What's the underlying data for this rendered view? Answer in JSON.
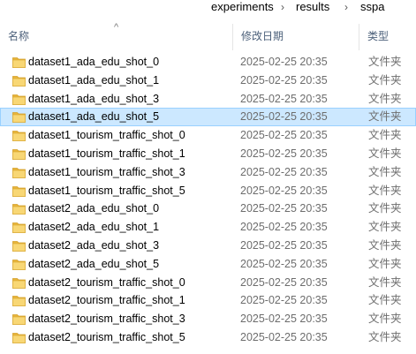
{
  "breadcrumb": {
    "items": [
      "experiments",
      "results",
      "sspa"
    ],
    "separator": "›"
  },
  "columns": {
    "name": "名称",
    "modified": "修改日期",
    "type": "类型",
    "sort_indicator": "^"
  },
  "selected_row_color": "#cce8ff",
  "folder_icon_color": "#f8d775",
  "rows": [
    {
      "name": "dataset1_ada_edu_shot_0",
      "modified": "2025-02-25 20:35",
      "type": "文件夹",
      "selected": false
    },
    {
      "name": "dataset1_ada_edu_shot_1",
      "modified": "2025-02-25 20:35",
      "type": "文件夹",
      "selected": false
    },
    {
      "name": "dataset1_ada_edu_shot_3",
      "modified": "2025-02-25 20:35",
      "type": "文件夹",
      "selected": false
    },
    {
      "name": "dataset1_ada_edu_shot_5",
      "modified": "2025-02-25 20:35",
      "type": "文件夹",
      "selected": true
    },
    {
      "name": "dataset1_tourism_traffic_shot_0",
      "modified": "2025-02-25 20:35",
      "type": "文件夹",
      "selected": false
    },
    {
      "name": "dataset1_tourism_traffic_shot_1",
      "modified": "2025-02-25 20:35",
      "type": "文件夹",
      "selected": false
    },
    {
      "name": "dataset1_tourism_traffic_shot_3",
      "modified": "2025-02-25 20:35",
      "type": "文件夹",
      "selected": false
    },
    {
      "name": "dataset1_tourism_traffic_shot_5",
      "modified": "2025-02-25 20:35",
      "type": "文件夹",
      "selected": false
    },
    {
      "name": "dataset2_ada_edu_shot_0",
      "modified": "2025-02-25 20:35",
      "type": "文件夹",
      "selected": false
    },
    {
      "name": "dataset2_ada_edu_shot_1",
      "modified": "2025-02-25 20:35",
      "type": "文件夹",
      "selected": false
    },
    {
      "name": "dataset2_ada_edu_shot_3",
      "modified": "2025-02-25 20:35",
      "type": "文件夹",
      "selected": false
    },
    {
      "name": "dataset2_ada_edu_shot_5",
      "modified": "2025-02-25 20:35",
      "type": "文件夹",
      "selected": false
    },
    {
      "name": "dataset2_tourism_traffic_shot_0",
      "modified": "2025-02-25 20:35",
      "type": "文件夹",
      "selected": false
    },
    {
      "name": "dataset2_tourism_traffic_shot_1",
      "modified": "2025-02-25 20:35",
      "type": "文件夹",
      "selected": false
    },
    {
      "name": "dataset2_tourism_traffic_shot_3",
      "modified": "2025-02-25 20:35",
      "type": "文件夹",
      "selected": false
    },
    {
      "name": "dataset2_tourism_traffic_shot_5",
      "modified": "2025-02-25 20:35",
      "type": "文件夹",
      "selected": false
    }
  ]
}
